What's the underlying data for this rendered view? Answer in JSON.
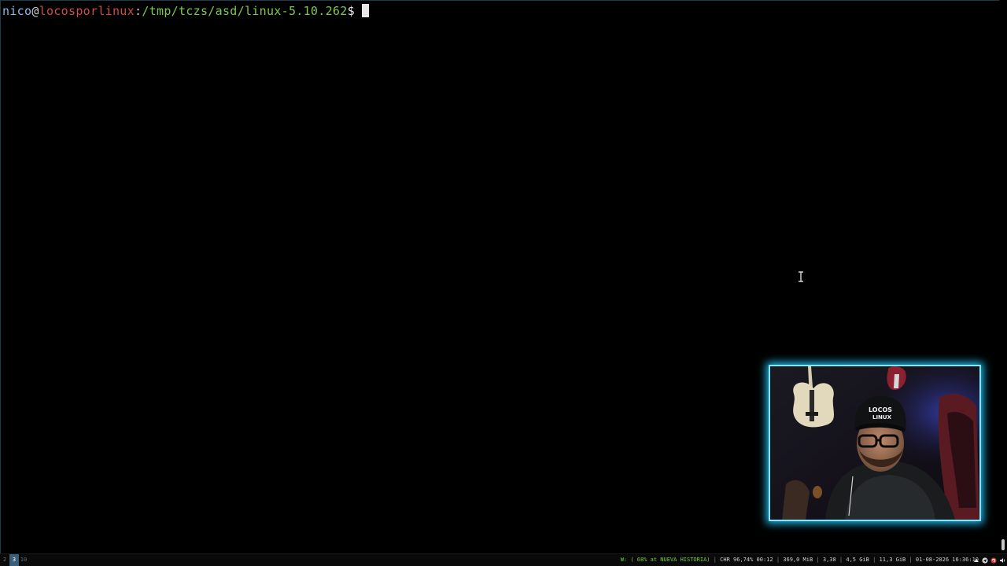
{
  "terminal": {
    "prompt": {
      "user": "nico",
      "at": "@",
      "host": "locosporlinux",
      "colon": ":",
      "path": "/tmp/tczs/asd/linux-5.10.262",
      "dollar": "$"
    },
    "colors": {
      "user": "#8fb8e8",
      "host": "#d04a4a",
      "path": "#7cc94c",
      "background": "#000000"
    }
  },
  "webcam": {
    "border_color": "#7fe8ff",
    "glow_color": "#21b8e8",
    "cap_text": "LOCOS\nLINUX"
  },
  "taskbar": {
    "workspaces": [
      {
        "label": "2",
        "active": false
      },
      {
        "label": "3",
        "active": true
      },
      {
        "label": "10",
        "active": false
      }
    ],
    "status": {
      "wifi": "W: ( 68% at NUEVA HISTORIA)",
      "battery": "CHR 96,74% 00:12",
      "memory": "369,0 MiB",
      "load": "3,38",
      "disk": "4,5 GiB",
      "ram": "11,3 GiB",
      "datetime": "01-08-2026 16:36:10"
    },
    "tray_icons": [
      "network-icon",
      "telegram-icon",
      "update-icon",
      "volume-icon"
    ],
    "accent_color": "#3b5e7a"
  }
}
